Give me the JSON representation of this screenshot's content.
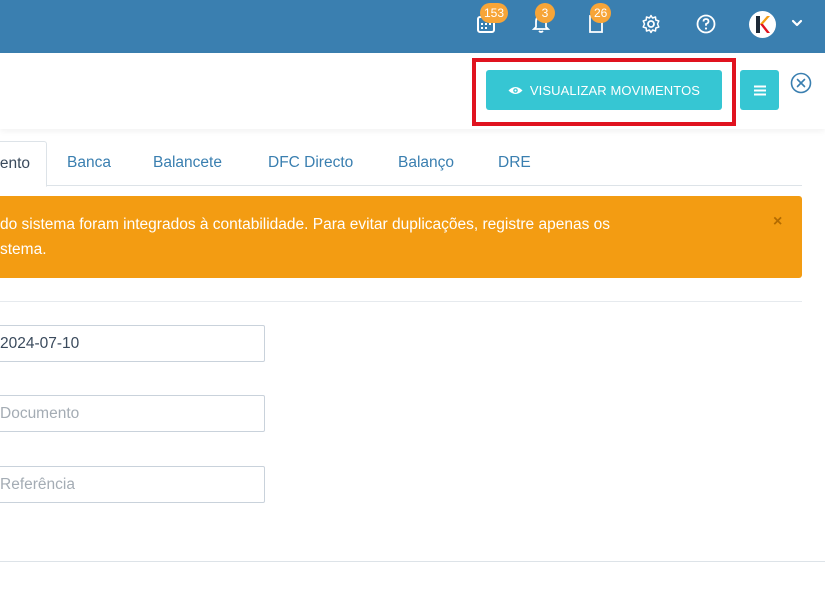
{
  "topbar": {
    "background": "#3a7fb0",
    "items": [
      {
        "icon": "calendar-icon",
        "badge": "153"
      },
      {
        "icon": "bell-icon",
        "badge": "3"
      },
      {
        "icon": "document-icon",
        "badge": "26"
      },
      {
        "icon": "gear-icon"
      },
      {
        "icon": "help-icon"
      }
    ],
    "avatar_letter": "K"
  },
  "header": {
    "visualize_button_label": "VISUALIZAR MOVIMENTOS",
    "accent_color": "#36c6d3",
    "highlight_color": "#e0131f"
  },
  "tabs": [
    {
      "label": "ento",
      "active": true
    },
    {
      "label": "Banca"
    },
    {
      "label": "Balancete"
    },
    {
      "label": "DFC Directo"
    },
    {
      "label": "Balanço"
    },
    {
      "label": "DRE"
    }
  ],
  "alert": {
    "line1": "do sistema foram integrados à contabilidade. Para evitar duplicações, registre apenas os",
    "line2": "stema.",
    "close": "×",
    "color": "#f39c12"
  },
  "form": {
    "date_value": "2024-07-10",
    "document_placeholder": "Documento",
    "reference_placeholder": "Referência"
  }
}
